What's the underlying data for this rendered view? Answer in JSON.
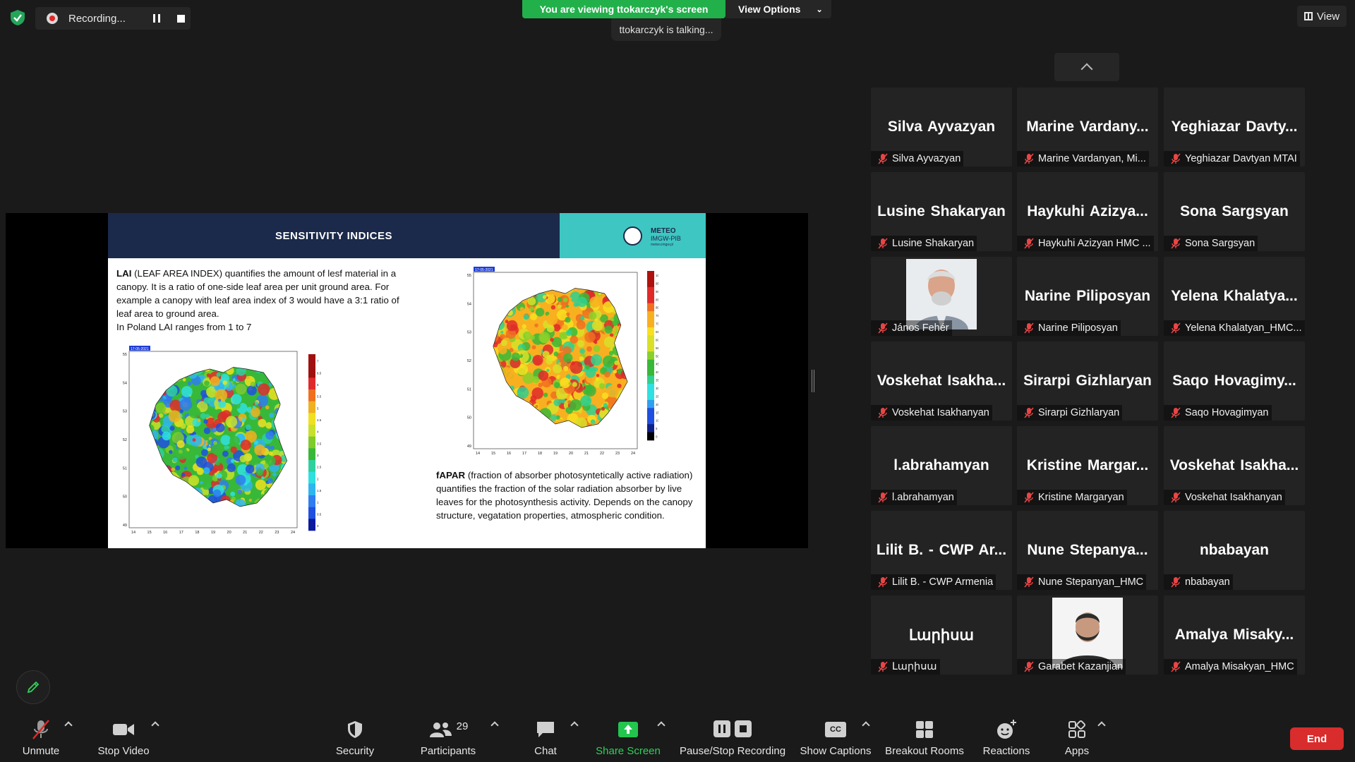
{
  "top_bar": {
    "recording_label": "Recording...",
    "viewing_banner": "You are viewing ttokarczyk's screen",
    "view_options_label": "View Options",
    "talking_indicator": "ttokarczyk is talking...",
    "view_button_label": "View"
  },
  "slide": {
    "title": "SENSITIVITY INDICES",
    "logo_line1": "METEO",
    "logo_line2": "IMGW-PIB",
    "logo_line3": "meteo.imgw.pl",
    "lai_term": "LAI",
    "lai_description": " (LEAF AREA INDEX) quantifies the amount of lesf material in a canopy. It is a ratio of one-side leaf area per unit ground area. For example a canopy with leaf area index of 3 would have a 3:1 ratio of leaf area to ground area.",
    "lai_range": "In Poland LAI ranges from 1 to 7",
    "fapar_term": "fAPAR",
    "fapar_description": " (fraction of absorber photosyntetically active radiation) quantifies the fraction of the solar radiation absorber by live leaves for the photosynthesis activity. Depends on the canopy structure, vegatation properties, atmospheric condition.",
    "lai_map": {
      "date": "17-05-2021",
      "lat_ticks": [
        "55",
        "54",
        "53",
        "52",
        "51",
        "50",
        "49"
      ],
      "lon_ticks": [
        "14",
        "15",
        "16",
        "17",
        "18",
        "19",
        "20",
        "21",
        "22",
        "23",
        "24"
      ],
      "scale": [
        "7",
        "6.5",
        "6",
        "5.5",
        "5",
        "4.5",
        "4",
        "3.5",
        "3",
        "2.5",
        "2",
        "1.5",
        "1",
        "0.5",
        "0"
      ]
    },
    "fapar_map": {
      "date": "17-05-2021",
      "lat_ticks": [
        "55",
        "54",
        "53",
        "52",
        "51",
        "50",
        "49"
      ],
      "lon_ticks": [
        "14",
        "15",
        "16",
        "17",
        "18",
        "19",
        "20",
        "21",
        "22",
        "23",
        "24"
      ],
      "scale": [
        "100",
        "95",
        "90",
        "85",
        "80",
        "75",
        "70",
        "65",
        "60",
        "55",
        "50",
        "45",
        "40",
        "35",
        "30",
        "25",
        "20",
        "15",
        "10",
        "5",
        "0"
      ]
    }
  },
  "participants": [
    {
      "display": "Silva Ayvazyan",
      "label": "Silva Ayvazyan"
    },
    {
      "display": "Marine Vardany...",
      "label": "Marine Vardanyan, Mi..."
    },
    {
      "display": "Yeghiazar Davty...",
      "label": "Yeghiazar Davtyan MTAI"
    },
    {
      "display": "Lusine Shakaryan",
      "label": "Lusine Shakaryan"
    },
    {
      "display": "Haykuhi Azizya...",
      "label": "Haykuhi Azizyan HMC ..."
    },
    {
      "display": "Sona Sargsyan",
      "label": "Sona Sargsyan"
    },
    {
      "display": "",
      "label": "János Fehér",
      "photo": "elderly-man-photo"
    },
    {
      "display": "Narine Piliposyan",
      "label": "Narine Piliposyan"
    },
    {
      "display": "Yelena Khalatya...",
      "label": "Yelena Khalatyan_HMC..."
    },
    {
      "display": "Voskehat Isakha...",
      "label": "Voskehat Isakhanyan"
    },
    {
      "display": "Sirarpi Gizhlaryan",
      "label": "Sirarpi Gizhlaryan"
    },
    {
      "display": "Saqo Hovagimy...",
      "label": "Saqo Hovagimyan"
    },
    {
      "display": "l.abrahamyan",
      "label": "l.abrahamyan"
    },
    {
      "display": "Kristine Margar...",
      "label": "Kristine Margaryan"
    },
    {
      "display": "Voskehat Isakha...",
      "label": "Voskehat Isakhanyan"
    },
    {
      "display": "Lilit B. - CWP Ar...",
      "label": "Lilit B. - CWP Armenia"
    },
    {
      "display": "Nune Stepanya...",
      "label": "Nune Stepanyan_HMC"
    },
    {
      "display": "nbabayan",
      "label": "nbabayan"
    },
    {
      "display": "Լարիսա",
      "label": "Լարիսա"
    },
    {
      "display": "",
      "label": "Garabet Kazanjian",
      "photo": "bearded-man-photo"
    },
    {
      "display": "Amalya Misaky...",
      "label": "Amalya Misakyan_HMC"
    }
  ],
  "toolbar": {
    "unmute": "Unmute",
    "stop_video": "Stop Video",
    "security": "Security",
    "participants": "Participants",
    "participants_count": "29",
    "chat": "Chat",
    "share_screen": "Share Screen",
    "pause_stop_recording": "Pause/Stop Recording",
    "show_captions": "Show Captions",
    "captions_badge": "CC",
    "breakout_rooms": "Breakout Rooms",
    "reactions": "Reactions",
    "apps": "Apps",
    "end": "End"
  },
  "colors": {
    "accent_green": "#22b04b",
    "end_red": "#d92c2c",
    "slide_navy": "#1b2a4a",
    "slide_teal": "#3ec6c2",
    "muted_red": "#e02828"
  }
}
